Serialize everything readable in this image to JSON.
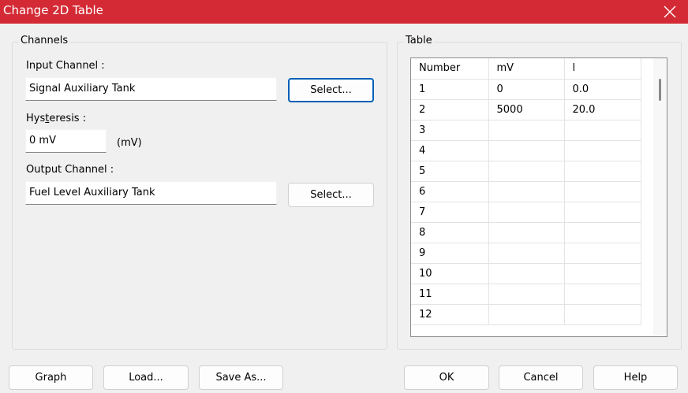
{
  "window": {
    "title": "Change 2D Table"
  },
  "channels": {
    "legend": "Channels",
    "input_label": "Input Channel :",
    "input_value": "Signal Auxiliary Tank",
    "select_label": "Select...",
    "hysteresis_label_pre": "Hys",
    "hysteresis_label_ul": "t",
    "hysteresis_label_post": "eresis :",
    "hysteresis_value": "0 mV",
    "hysteresis_unit": "(mV)",
    "output_label": "Output Channel :",
    "output_value": "Fuel Level Auxiliary Tank",
    "select2_label": "Select..."
  },
  "table": {
    "legend": "Table",
    "columns": [
      "Number",
      "mV",
      "l"
    ],
    "rows": [
      [
        "1",
        "0",
        "0.0"
      ],
      [
        "2",
        "5000",
        "20.0"
      ],
      [
        "3",
        "",
        ""
      ],
      [
        "4",
        "",
        ""
      ],
      [
        "5",
        "",
        ""
      ],
      [
        "6",
        "",
        ""
      ],
      [
        "7",
        "",
        ""
      ],
      [
        "8",
        "",
        ""
      ],
      [
        "9",
        "",
        ""
      ],
      [
        "10",
        "",
        ""
      ],
      [
        "11",
        "",
        ""
      ],
      [
        "12",
        "",
        ""
      ]
    ]
  },
  "buttons": {
    "graph": "Graph",
    "load": "Load...",
    "save_as": "Save As...",
    "ok": "OK",
    "cancel": "Cancel",
    "help": "Help"
  },
  "icons": {
    "close": "close-icon"
  },
  "colors": {
    "titlebar": "#d42a35",
    "focus_border": "#005fb8"
  }
}
